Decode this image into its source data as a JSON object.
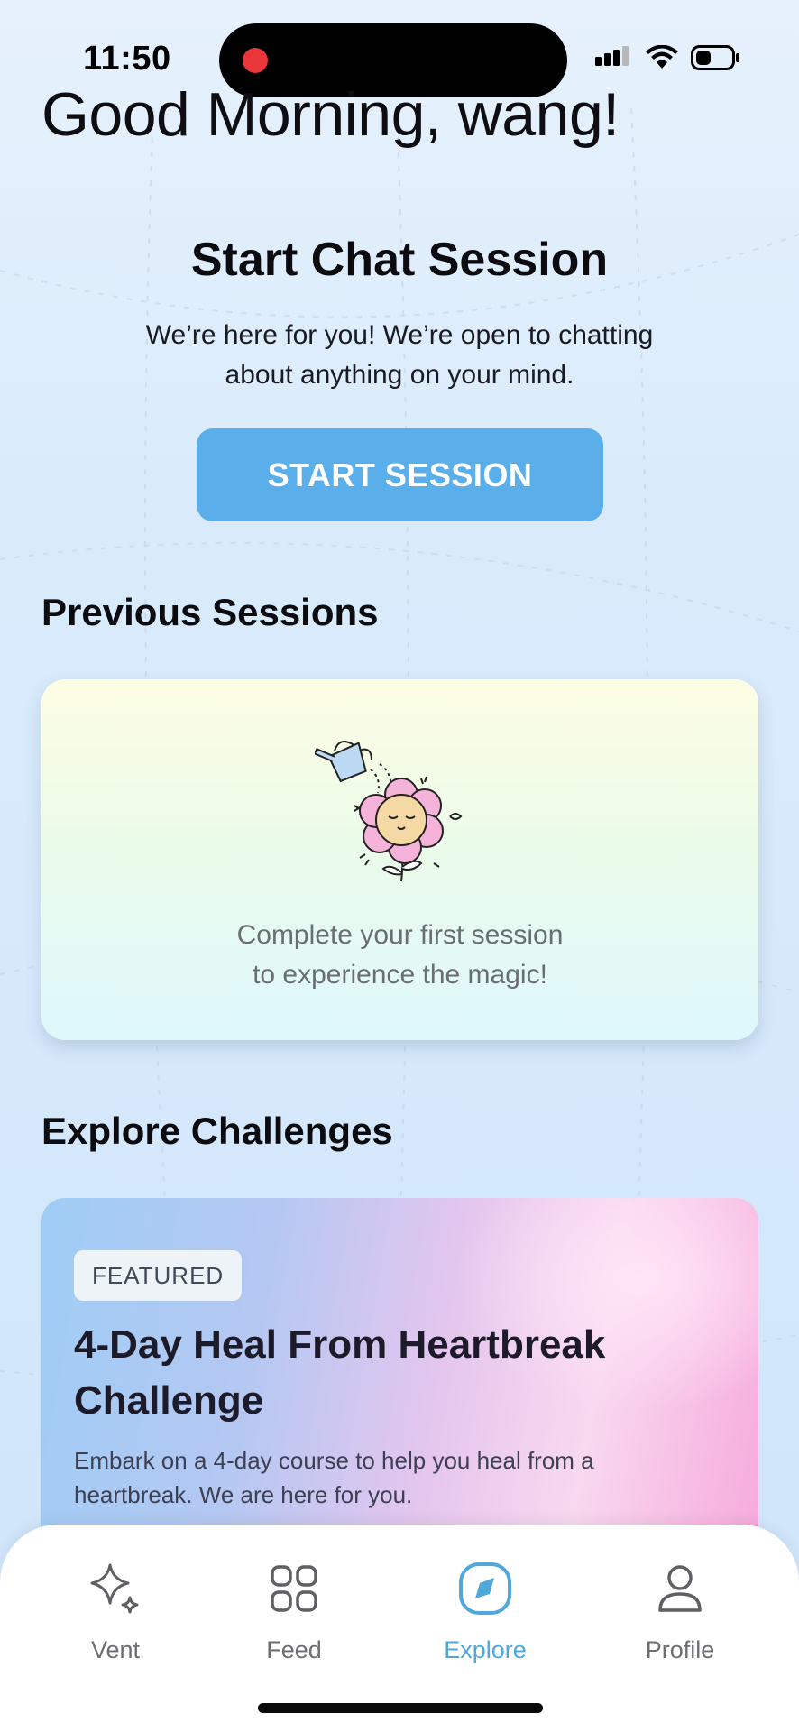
{
  "status_bar": {
    "time": "11:50",
    "icons": [
      "recording-dot-icon",
      "signal-icon",
      "wifi-icon",
      "battery-icon"
    ]
  },
  "greeting": "Good Morning, wang!",
  "chat_session": {
    "title": "Start Chat Session",
    "description": "We’re here for you! We’re open to chatting about anything on your mind.",
    "button_label": "START SESSION"
  },
  "previous_sessions": {
    "heading": "Previous Sessions",
    "empty_line1": "Complete your first session",
    "empty_line2": "to experience the magic!"
  },
  "explore": {
    "heading": "Explore Challenges",
    "featured_card": {
      "badge": "FEATURED",
      "title": "4-Day Heal From Heartbreak Challenge",
      "description": "Embark on a 4-day course to help you heal from a heartbreak. We are here for you."
    }
  },
  "bottom_nav": {
    "items": [
      {
        "label": "Vent",
        "icon": "sparkle-icon",
        "active": false
      },
      {
        "label": "Feed",
        "icon": "grid-icon",
        "active": false
      },
      {
        "label": "Explore",
        "icon": "compass-icon",
        "active": true
      },
      {
        "label": "Profile",
        "icon": "person-icon",
        "active": false
      }
    ]
  },
  "colors": {
    "accent": "#5aaee9",
    "active_nav": "#4fa8d8",
    "recording": "#e8363a"
  }
}
